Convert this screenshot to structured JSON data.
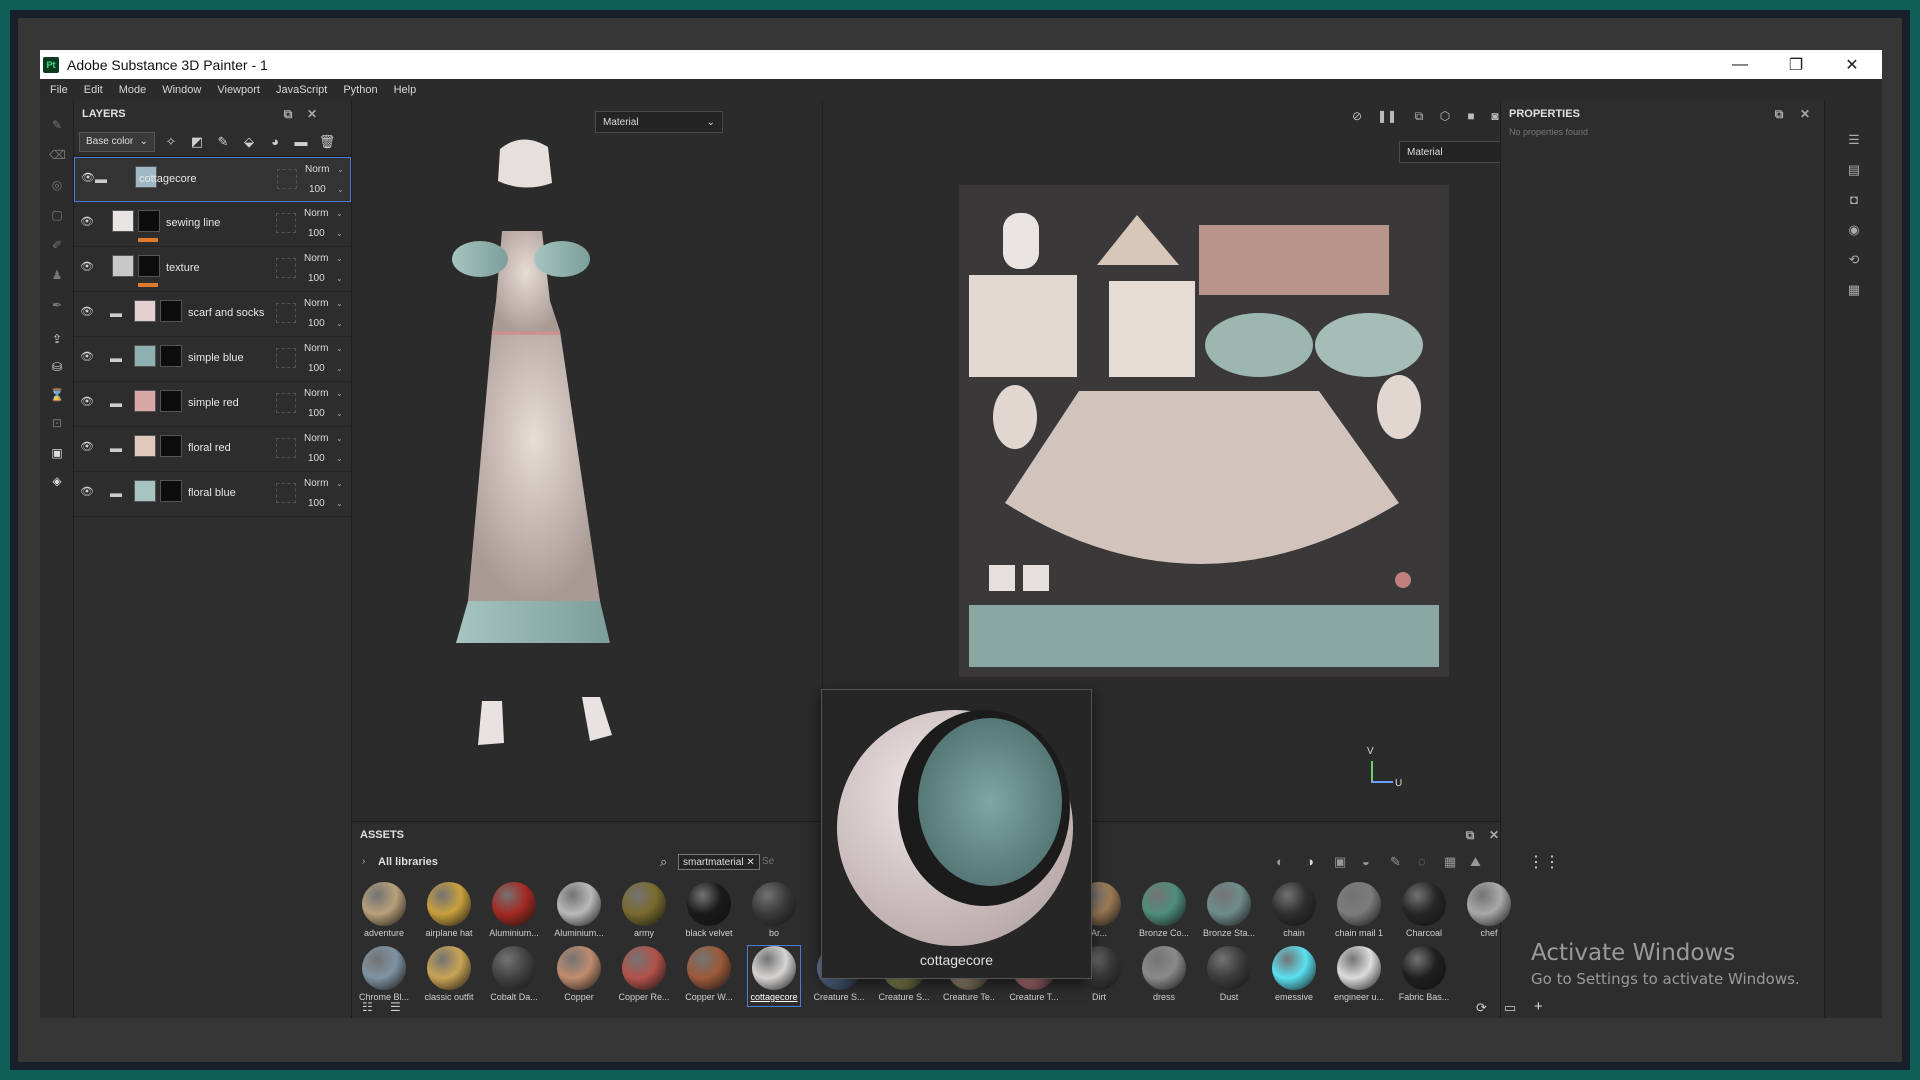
{
  "window": {
    "title": "Adobe Substance 3D Painter - 1",
    "app_icon": "Pt",
    "controls": {
      "minimize": "—",
      "maximize": "❐",
      "close": "✕"
    }
  },
  "menu": [
    "File",
    "Edit",
    "Mode",
    "Window",
    "Viewport",
    "JavaScript",
    "Python",
    "Help"
  ],
  "layers": {
    "title": "LAYERS",
    "channel": "Base color",
    "items": [
      {
        "name": "cottagecore",
        "blend": "Norm",
        "opacity": "100",
        "active": true,
        "color": "#9fb8c6"
      },
      {
        "name": "sewing line",
        "blend": "Norm",
        "opacity": "100",
        "color": "#e8e4e4"
      },
      {
        "name": "texture",
        "blend": "Norm",
        "opacity": "100",
        "color": "#c8c8c8"
      },
      {
        "name": "scarf and socks",
        "blend": "Norm",
        "opacity": "100",
        "color": "#e4cfcf"
      },
      {
        "name": "simple blue",
        "blend": "Norm",
        "opacity": "100",
        "color": "#8fb0b0"
      },
      {
        "name": "simple red",
        "blend": "Norm",
        "opacity": "100",
        "color": "#d9a6a6"
      },
      {
        "name": "floral red",
        "blend": "Norm",
        "opacity": "100",
        "color": "#e0c8bc"
      },
      {
        "name": "floral blue",
        "blend": "Norm",
        "opacity": "100",
        "color": "#a8c4c0"
      }
    ]
  },
  "viewport3d": {
    "mode": "Material"
  },
  "viewport2d": {
    "mode": "Material",
    "axis_v": "V",
    "axis_u": "U"
  },
  "properties": {
    "title": "PROPERTIES",
    "empty": "No properties found"
  },
  "assets": {
    "title": "ASSETS",
    "library": "All libraries",
    "filter_chip": "smartmaterial",
    "search_placeholder": "Se",
    "row1": [
      "adventure",
      "airplane hat",
      "Aluminium...",
      "Aluminium...",
      "army",
      "black velvet",
      "bo",
      "",
      "",
      "",
      "",
      "Ar...",
      "Bronze Co...",
      "Bronze Sta...",
      "chain",
      "chain mail 1",
      "Charcoal",
      "chef"
    ],
    "row2": [
      "Chrome Bl...",
      "classic outfit",
      "Cobalt Da...",
      "Copper",
      "Copper Re...",
      "Copper W...",
      "cottagecore",
      "Creature S...",
      "Creature S...",
      "Creature Te...",
      "Creature T...",
      "Dirt",
      "dress",
      "Dust",
      "emessive",
      "engineer u...",
      "Fabric Bas..."
    ],
    "row1_colors": [
      "#b8a07a",
      "#c9a03c",
      "#a32a22",
      "#b9b9b9",
      "#7a6a2e",
      "#1a1a1a",
      "#3a3a3a",
      "",
      "",
      "",
      "",
      "#9c7a55",
      "#4f8d7c",
      "#6f8c8a",
      "#2e2e2e",
      "#7c7c7c",
      "#262626",
      "#a9a9a9"
    ],
    "row2_colors": [
      "#7f93a3",
      "#c9a455",
      "#424242",
      "#c08c6e",
      "#b2524a",
      "#9c5a3a",
      "#d8d4d4",
      "#5f7da6",
      "#a4a560",
      "#b9a488",
      "#d9888e",
      "#3a3a3a",
      "#8a8a8a",
      "#3c3c3c",
      "#5ae0ef",
      "#dcdcdc",
      "#1f1f1f"
    ],
    "hover_preview": "cottagecore"
  },
  "watermark": {
    "line1": "Activate Windows",
    "line2": "Go to Settings to activate Windows."
  }
}
